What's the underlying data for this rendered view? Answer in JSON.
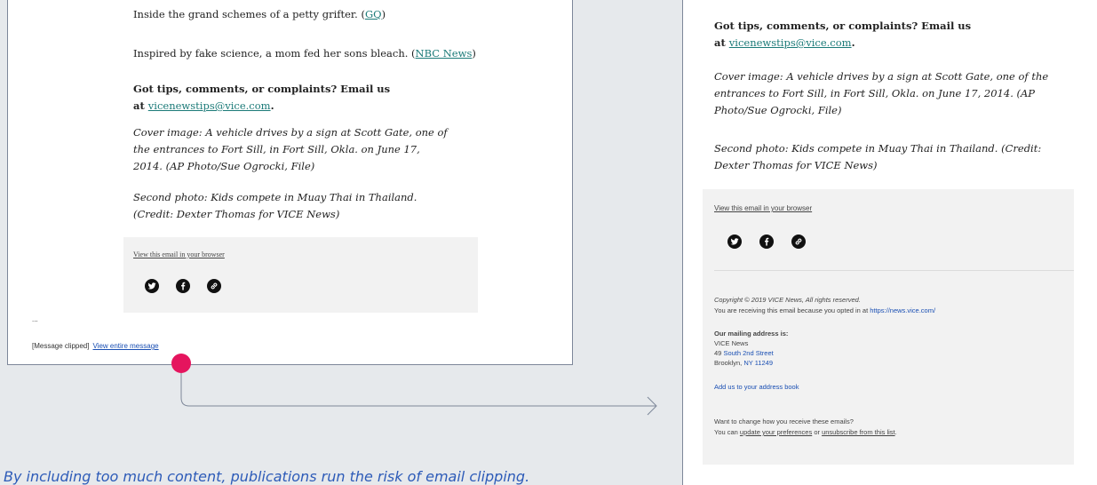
{
  "left": {
    "line1_text": "Inside the grand schemes of a petty grifter. (",
    "line1_link": "GQ",
    "line1_end": ")",
    "line2_text": "Inspired by fake science, a mom fed her sons bleach. (",
    "line2_link": "NBC News",
    "line2_end": ")",
    "tips_line1": "Got tips, comments, or complaints? Email us",
    "tips_at": "at ",
    "tips_email": "vicenewstips@vice.com",
    "tips_end": ".",
    "cover_caption": "Cover image: A vehicle drives by a sign at Scott Gate, one of the entrances to Fort Sill, in Fort Sill, Okla. on June 17, 2014. (AP Photo/Sue Ogrocki, File)",
    "second_caption": "Second photo: Kids compete in Muay Thai in Thailand. (Credit: Dexter Thomas for VICE News)",
    "view_browser": "View this email in your browser",
    "ellipsis": "...",
    "clipped_label": "[Message clipped]",
    "view_entire": "View entire message"
  },
  "right": {
    "tips_line1": "Got tips, comments, or complaints? Email us",
    "tips_at": "at ",
    "tips_email": "vicenewstips@vice.com",
    "tips_end": ".",
    "cover_caption": "Cover image: A vehicle drives by a sign at Scott Gate, one of the entrances to Fort Sill, in Fort Sill, Okla. on June 17, 2014. (AP Photo/Sue Ogrocki, File)",
    "second_caption": "Second photo: Kids compete in Muay Thai in Thailand. (Credit: Dexter Thomas for VICE News)",
    "view_browser": "View this email in your browser",
    "copyright": "Copyright © 2019 VICE News, All rights reserved.",
    "receiving_text": "You are receiving this email because you opted in at ",
    "receiving_link": "https://news.vice.com/",
    "mailing_heading": "Our mailing address is:",
    "address_name": "VICE News",
    "address_num": "49 ",
    "address_street": "South 2nd Street",
    "address_city": "Brooklyn, ",
    "address_state": "NY 11249",
    "add_book": "Add us to your address book",
    "change_q": "Want to change how you receive these emails?",
    "change_text": "You can ",
    "update_prefs": "update your preferences",
    "or_text": " or ",
    "unsubscribe": "unsubscribe from this list",
    "end_period": "."
  },
  "social_icons": [
    "twitter-icon",
    "facebook-icon",
    "link-icon"
  ],
  "caption": "By including too much content, publications run the risk of email clipping."
}
